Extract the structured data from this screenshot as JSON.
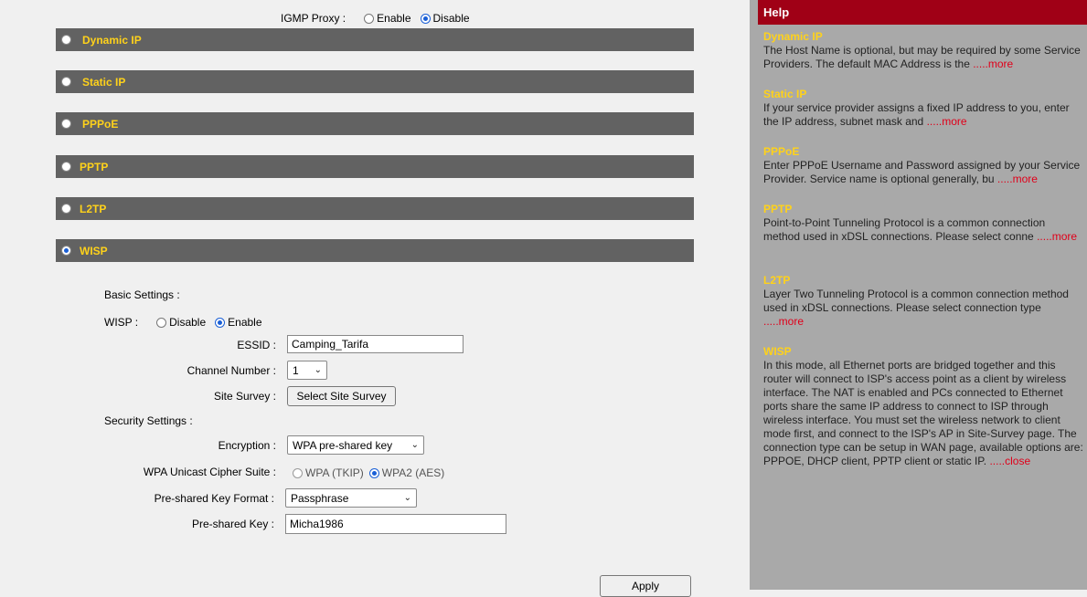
{
  "igmp": {
    "label": "IGMP Proxy :",
    "enable": "Enable",
    "disable": "Disable",
    "selected": "Disable"
  },
  "wan_types": [
    {
      "label": "Dynamic IP",
      "selected": false
    },
    {
      "label": "Static IP",
      "selected": false
    },
    {
      "label": "PPPoE",
      "selected": false
    },
    {
      "label": "PPTP",
      "selected": false
    },
    {
      "label": "L2TP",
      "selected": false
    },
    {
      "label": "WISP",
      "selected": true
    }
  ],
  "wisp": {
    "basic_settings": "Basic Settings :",
    "wisp_label": "WISP :",
    "disable": "Disable",
    "enable": "Enable",
    "selected": "Enable",
    "essid_label": "ESSID :",
    "essid_value": "Camping_Tarifa",
    "channel_label": "Channel Number :",
    "channel_value": "1",
    "site_survey_label": "Site Survey :",
    "site_survey_button": "Select Site Survey",
    "security_settings": "Security Settings :",
    "encryption_label": "Encryption :",
    "encryption_value": "WPA pre-shared key",
    "cipher_label": "WPA Unicast Cipher Suite :",
    "cipher_tkip": "WPA (TKIP)",
    "cipher_aes": "WPA2 (AES)",
    "cipher_selected": "WPA2 (AES)",
    "psk_format_label": "Pre-shared Key Format :",
    "psk_format_value": "Passphrase",
    "psk_label": "Pre-shared Key :",
    "psk_value": "Micha1986",
    "apply_button": "Apply"
  },
  "help": {
    "header": "Help",
    "sections": [
      {
        "title": "Dynamic IP",
        "text": "The Host Name is optional, but may be required by some Service Providers. The default MAC Address is the ",
        "link": ".....more"
      },
      {
        "title": "Static IP",
        "text": "If your service provider assigns a fixed IP address to you, enter the IP address, subnet mask and ",
        "link": ".....more"
      },
      {
        "title": "PPPoE",
        "text": "Enter PPPoE Username and Password assigned by your Service Provider. Service name is optional generally, bu ",
        "link": ".....more"
      },
      {
        "title": "PPTP",
        "text": "Point-to-Point Tunneling Protocol is a common connection method used in xDSL connections. Please select conne ",
        "link": ".....more"
      },
      {
        "title": "L2TP",
        "text": "Layer Two Tunneling Protocol is a common connection method used in xDSL connections. Please select connection type ",
        "link": ".....more"
      },
      {
        "title": "WISP",
        "text": "In this mode, all Ethernet ports are bridged together and this router will connect to ISP's access point as a client by wireless interface. The NAT is enabled and PCs connected to Ethernet ports share the same IP address to connect to ISP through wireless interface. You must set the wireless network to client mode first, and connect to the ISP's AP in Site-Survey page. The connection type can be setup in WAN page, available options are: PPPOE, DHCP client, PPTP client or static IP. ",
        "link": ".....close"
      }
    ]
  },
  "colors": {
    "bar": "#626262",
    "bar_label": "#ffd21a",
    "help_header": "#a00016",
    "help_panel": "#a9a9a9",
    "link": "#e0001a"
  }
}
